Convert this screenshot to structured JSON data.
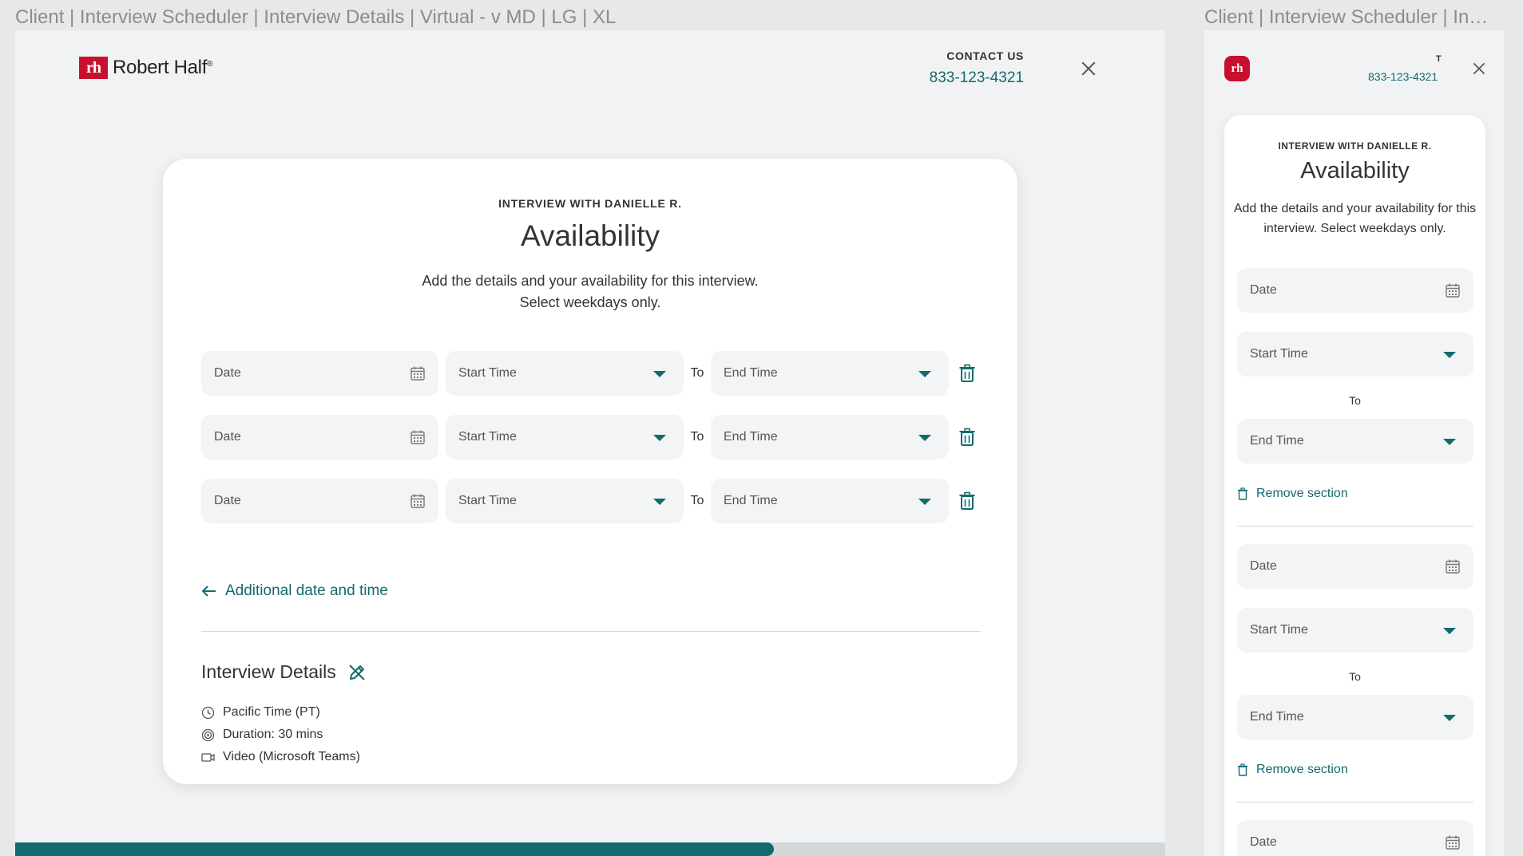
{
  "frame_labels": {
    "left": "Client | Interview Scheduler | Interview Details | Virtual - v MD | LG | XL",
    "right": "Client | Interview Scheduler | Inte..."
  },
  "brand": {
    "logo_text": "Robert Half",
    "logo_mark": "rh",
    "color": "#c8102e"
  },
  "contact": {
    "label": "CONTACT US",
    "phone": "833-123-4321"
  },
  "mobile_contact": {
    "label": "T",
    "phone": "833-123-4321"
  },
  "card": {
    "eyebrow": "INTERVIEW WITH DANIELLE R.",
    "title": "Availability",
    "desc_line1": "Add the details and your availability for this interview.",
    "desc_line2": "Select weekdays only."
  },
  "mobile_card": {
    "eyebrow": "INTERVIEW WITH DANIELLE R.",
    "title": "Availability",
    "desc": "Add the details and your availability for this interview. Select weekdays only."
  },
  "slots": [
    {
      "date_placeholder": "Date",
      "start_placeholder": "Start Time",
      "to_label": "To",
      "end_placeholder": "End Time"
    },
    {
      "date_placeholder": "Date",
      "start_placeholder": "Start Time",
      "to_label": "To",
      "end_placeholder": "End Time"
    },
    {
      "date_placeholder": "Date",
      "start_placeholder": "Start Time",
      "to_label": "To",
      "end_placeholder": "End Time"
    }
  ],
  "mobile_slots": [
    {
      "date_placeholder": "Date",
      "start_placeholder": "Start Time",
      "to_label": "To",
      "end_placeholder": "End Time",
      "remove_label": "Remove section"
    },
    {
      "date_placeholder": "Date",
      "start_placeholder": "Start Time",
      "to_label": "To",
      "end_placeholder": "End Time",
      "remove_label": "Remove section"
    },
    {
      "date_placeholder": "Date"
    }
  ],
  "add_link": "Additional date and time",
  "details": {
    "title": "Interview Details",
    "timezone": "Pacific Time (PT)",
    "duration": "Duration: 30 mins",
    "format": "Video (Microsoft Teams)"
  },
  "progress_fraction": 0.66,
  "accent_color": "#136a6e",
  "icons": [
    "calendar-icon",
    "caret-down-icon",
    "trash-icon",
    "arrow-left-icon",
    "edit-icon",
    "clock-icon",
    "duration-icon",
    "video-icon",
    "close-icon"
  ]
}
